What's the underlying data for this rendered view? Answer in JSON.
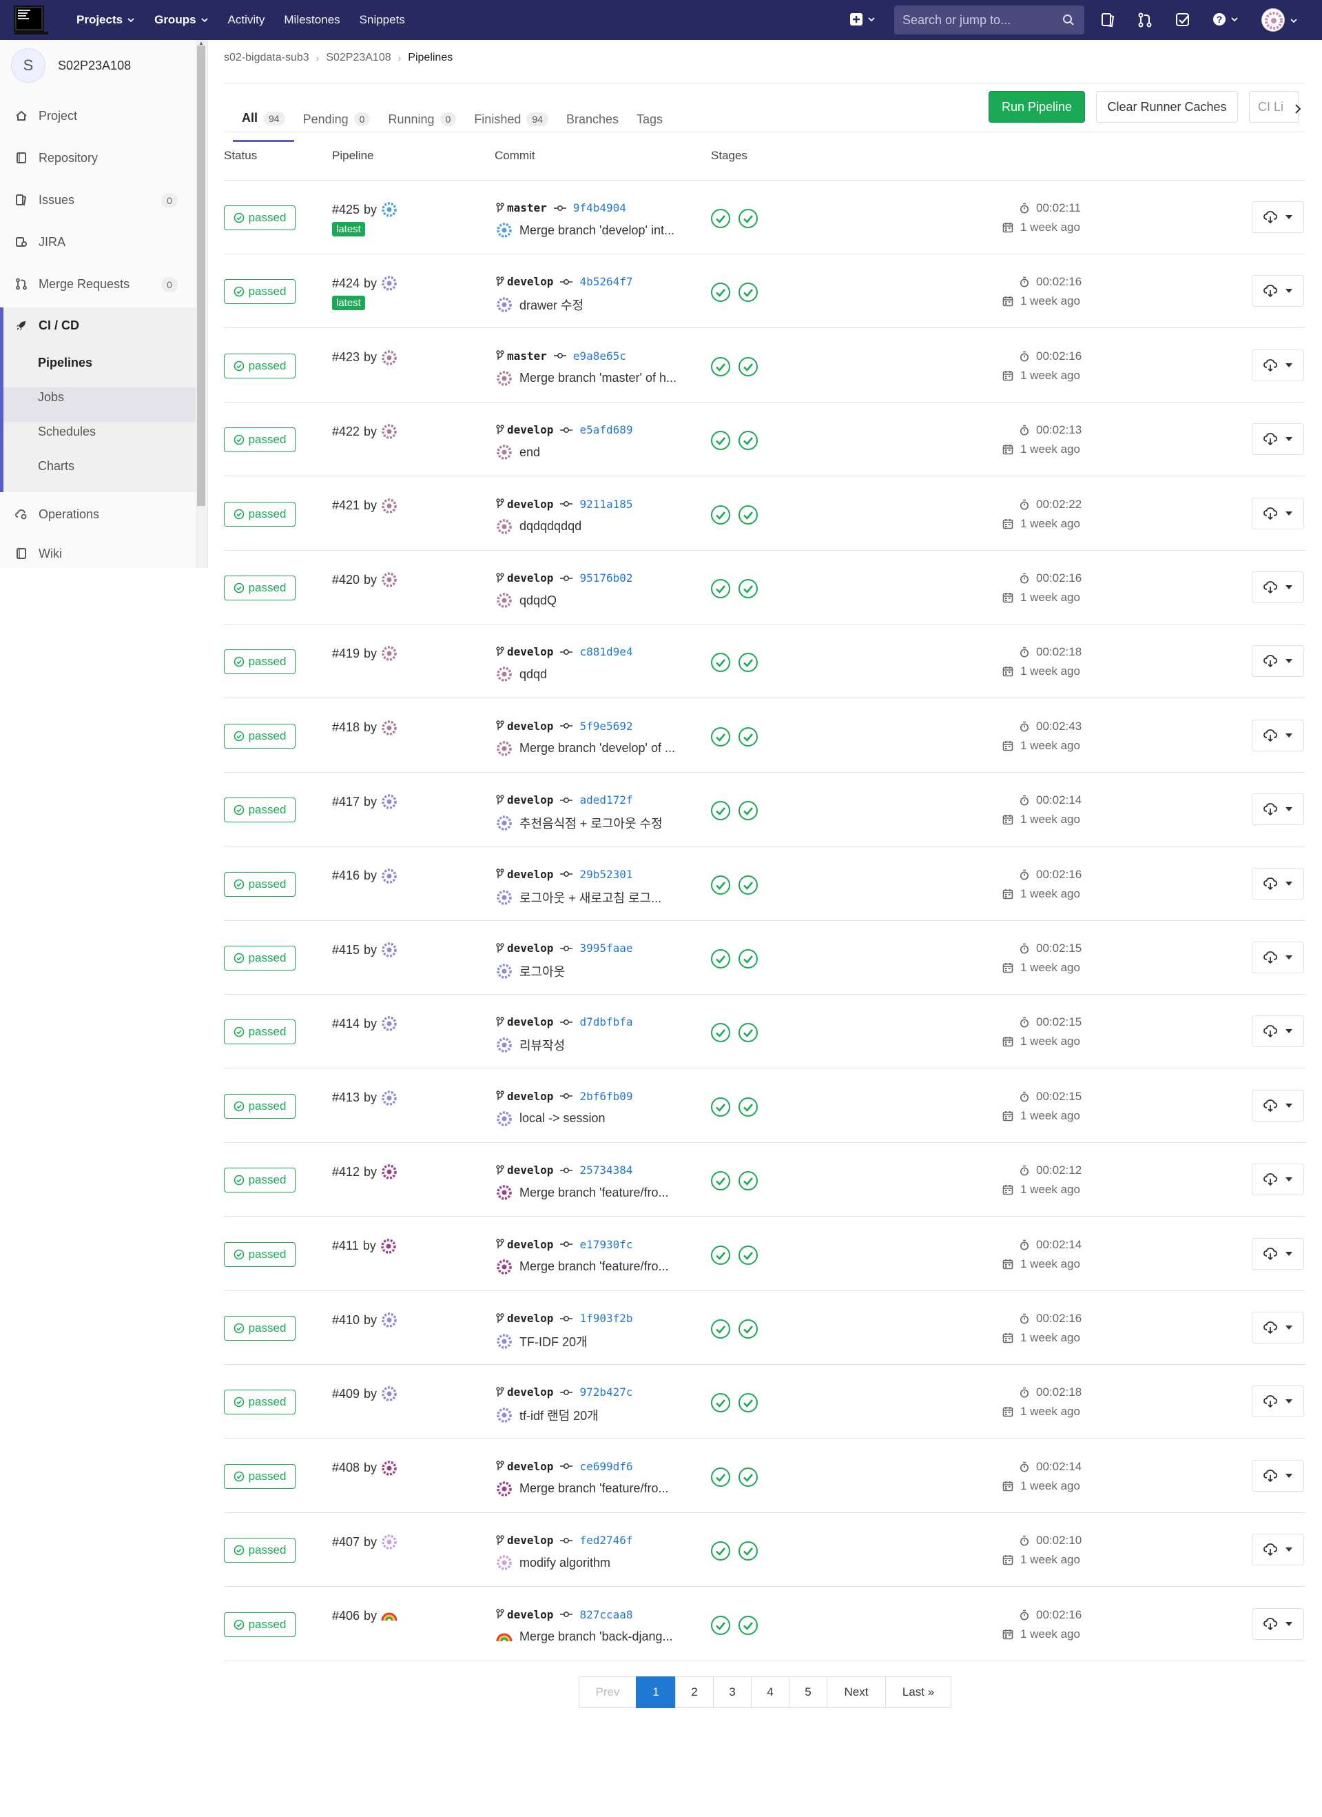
{
  "topnav": {
    "items": [
      "Projects",
      "Groups",
      "Activity",
      "Milestones",
      "Snippets"
    ],
    "search_placeholder": "Search or jump to..."
  },
  "sidebar": {
    "project_initial": "S",
    "project_name": "S02P23A108",
    "items": [
      {
        "label": "Project",
        "icon": "home-icon"
      },
      {
        "label": "Repository",
        "icon": "book-icon"
      },
      {
        "label": "Issues",
        "icon": "issues-icon",
        "count": "0"
      },
      {
        "label": "JIRA",
        "icon": "jira-icon"
      },
      {
        "label": "Merge Requests",
        "icon": "merge-request-icon",
        "count": "0"
      },
      {
        "label": "CI / CD",
        "icon": "rocket-icon"
      },
      {
        "label": "Operations",
        "icon": "cloud-gear-icon"
      },
      {
        "label": "Wiki",
        "icon": "book-icon"
      }
    ],
    "cicd_sub": [
      "Pipelines",
      "Jobs",
      "Schedules",
      "Charts"
    ]
  },
  "breadcrumb": [
    "s02-bigdata-sub3",
    "S02P23A108",
    "Pipelines"
  ],
  "tabs": [
    {
      "label": "All",
      "count": "94"
    },
    {
      "label": "Pending",
      "count": "0"
    },
    {
      "label": "Running",
      "count": "0"
    },
    {
      "label": "Finished",
      "count": "94"
    },
    {
      "label": "Branches"
    },
    {
      "label": "Tags"
    }
  ],
  "buttons": {
    "run": "Run Pipeline",
    "clear": "Clear Runner Caches",
    "ci_lint": "CI Li"
  },
  "table": {
    "headers": [
      "Status",
      "Pipeline",
      "Commit",
      "Stages"
    ],
    "status_label": "passed",
    "by": "by",
    "latest": "latest"
  },
  "rows": [
    {
      "id": "#425",
      "latest": true,
      "branch": "master",
      "sha": "9f4b4904",
      "msg": "Merge branch 'develop' int...",
      "duration": "00:02:11",
      "ago": "1 week ago",
      "avatar": "#4aa3df"
    },
    {
      "id": "#424",
      "latest": true,
      "branch": "develop",
      "sha": "4b5264f7",
      "msg": "drawer 수정",
      "duration": "00:02:16",
      "ago": "1 week ago",
      "avatar": "#8b8bd9"
    },
    {
      "id": "#423",
      "latest": false,
      "branch": "master",
      "sha": "e9a8e65c",
      "msg": "Merge branch 'master' of h...",
      "duration": "00:02:16",
      "ago": "1 week ago",
      "avatar": "#b07a9a"
    },
    {
      "id": "#422",
      "latest": false,
      "branch": "develop",
      "sha": "e5afd689",
      "msg": "end",
      "duration": "00:02:13",
      "ago": "1 week ago",
      "avatar": "#b07a9a"
    },
    {
      "id": "#421",
      "latest": false,
      "branch": "develop",
      "sha": "9211a185",
      "msg": "dqdqdqdqd",
      "duration": "00:02:22",
      "ago": "1 week ago",
      "avatar": "#b07a9a"
    },
    {
      "id": "#420",
      "latest": false,
      "branch": "develop",
      "sha": "95176b02",
      "msg": "qdqdQ",
      "duration": "00:02:16",
      "ago": "1 week ago",
      "avatar": "#b07a9a"
    },
    {
      "id": "#419",
      "latest": false,
      "branch": "develop",
      "sha": "c881d9e4",
      "msg": "qdqd",
      "duration": "00:02:18",
      "ago": "1 week ago",
      "avatar": "#b07a9a"
    },
    {
      "id": "#418",
      "latest": false,
      "branch": "develop",
      "sha": "5f9e5692",
      "msg": "Merge branch 'develop' of ...",
      "duration": "00:02:43",
      "ago": "1 week ago",
      "avatar": "#b07a9a"
    },
    {
      "id": "#417",
      "latest": false,
      "branch": "develop",
      "sha": "aded172f",
      "msg": "추천음식점 + 로그아웃 수정",
      "duration": "00:02:14",
      "ago": "1 week ago",
      "avatar": "#8b8bd9"
    },
    {
      "id": "#416",
      "latest": false,
      "branch": "develop",
      "sha": "29b52301",
      "msg": "로그아웃 + 새로고침 로그...",
      "duration": "00:02:16",
      "ago": "1 week ago",
      "avatar": "#8b8bd9"
    },
    {
      "id": "#415",
      "latest": false,
      "branch": "develop",
      "sha": "3995faae",
      "msg": "로그아웃",
      "duration": "00:02:15",
      "ago": "1 week ago",
      "avatar": "#8b8bd9"
    },
    {
      "id": "#414",
      "latest": false,
      "branch": "develop",
      "sha": "d7dbfbfa",
      "msg": "리뷰작성",
      "duration": "00:02:15",
      "ago": "1 week ago",
      "avatar": "#8b8bd9"
    },
    {
      "id": "#413",
      "latest": false,
      "branch": "develop",
      "sha": "2bf6fb09",
      "msg": "local -> session",
      "duration": "00:02:15",
      "ago": "1 week ago",
      "avatar": "#8b8bd9"
    },
    {
      "id": "#412",
      "latest": false,
      "branch": "develop",
      "sha": "25734384",
      "msg": "Merge branch 'feature/fro...",
      "duration": "00:02:12",
      "ago": "1 week ago",
      "avatar": "#a03a8a"
    },
    {
      "id": "#411",
      "latest": false,
      "branch": "develop",
      "sha": "e17930fc",
      "msg": "Merge branch 'feature/fro...",
      "duration": "00:02:14",
      "ago": "1 week ago",
      "avatar": "#a03a8a"
    },
    {
      "id": "#410",
      "latest": false,
      "branch": "develop",
      "sha": "1f903f2b",
      "msg": "TF-IDF 20개",
      "duration": "00:02:16",
      "ago": "1 week ago",
      "avatar": "#8b8bd9"
    },
    {
      "id": "#409",
      "latest": false,
      "branch": "develop",
      "sha": "972b427c",
      "msg": "tf-idf 랜덤 20개",
      "duration": "00:02:18",
      "ago": "1 week ago",
      "avatar": "#8b8bd9"
    },
    {
      "id": "#408",
      "latest": false,
      "branch": "develop",
      "sha": "ce699df6",
      "msg": "Merge branch 'feature/fro...",
      "duration": "00:02:14",
      "ago": "1 week ago",
      "avatar": "#a03a8a"
    },
    {
      "id": "#407",
      "latest": false,
      "branch": "develop",
      "sha": "fed2746f",
      "msg": "modify algorithm",
      "duration": "00:02:10",
      "ago": "1 week ago",
      "avatar": "#c9a0e0"
    },
    {
      "id": "#406",
      "latest": false,
      "branch": "develop",
      "sha": "827ccaa8",
      "msg": "Merge branch 'back-djang...",
      "duration": "00:02:16",
      "ago": "1 week ago",
      "avatar": "rainbow"
    }
  ],
  "pagination": {
    "prev": "Prev",
    "pages": [
      "1",
      "2",
      "3",
      "4",
      "5"
    ],
    "next": "Next",
    "last": "Last »",
    "current": "1"
  }
}
